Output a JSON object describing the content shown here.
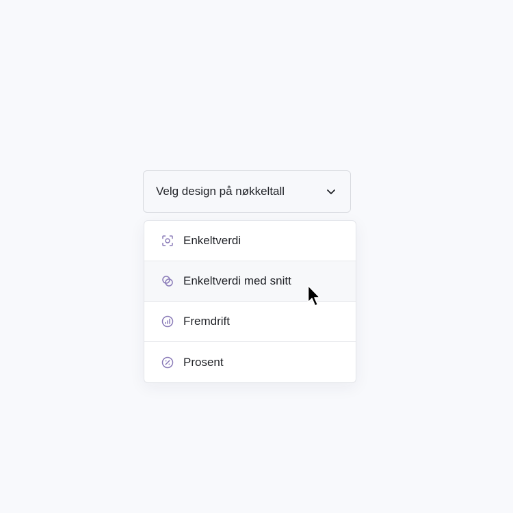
{
  "select": {
    "placeholder": "Velg design på nøkkeltall",
    "icon": "chevron-down-icon"
  },
  "menu": {
    "items": [
      {
        "label": "Enkeltverdi",
        "icon": "focus-target-icon",
        "hovered": false
      },
      {
        "label": "Enkeltverdi med snitt",
        "icon": "overlapping-circles-icon",
        "hovered": true
      },
      {
        "label": "Fremdrift",
        "icon": "bar-chart-circle-icon",
        "hovered": false
      },
      {
        "label": "Prosent",
        "icon": "percent-circle-icon",
        "hovered": false
      }
    ]
  },
  "colors": {
    "accent": "#8a7bb8",
    "background": "#f8f9fc",
    "text": "#1f2126",
    "border": "#e6e7eb"
  }
}
